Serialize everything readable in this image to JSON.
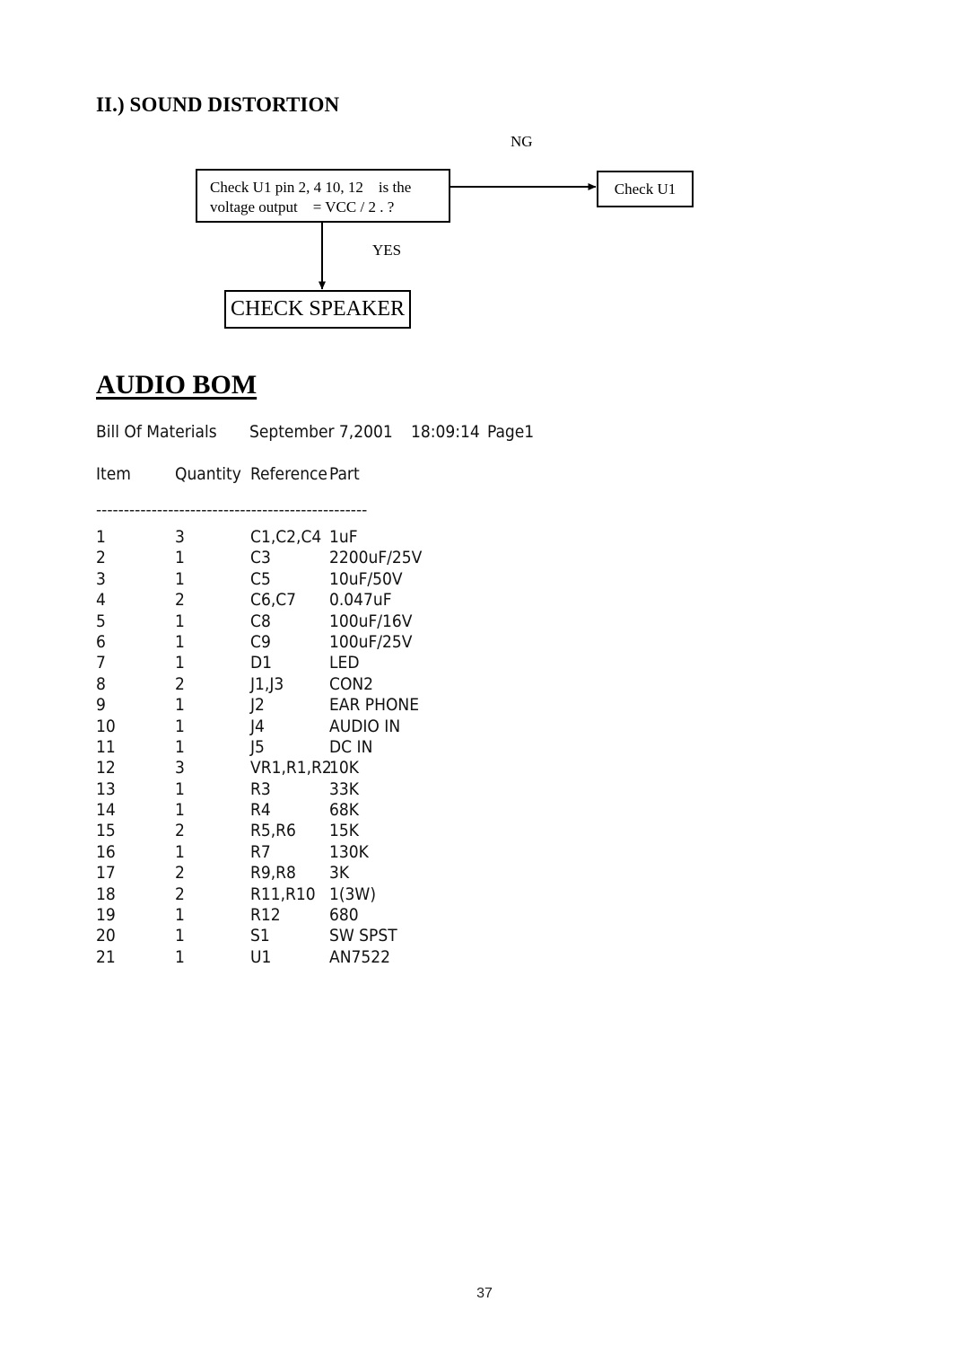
{
  "document": {
    "section_heading": "II.) SOUND DISTORTION",
    "page_number": "37"
  },
  "flowchart": {
    "decision_line1": "Check U1 pin 2, 4 10, 12    is the",
    "decision_line2": "voltage output    = VCC / 2 . ?",
    "branch_ng_label": "NG",
    "branch_yes_label": "YES",
    "ng_target": "Check U1",
    "yes_target": "CHECK SPEAKER"
  },
  "bom": {
    "heading": "AUDIO BOM",
    "meta": {
      "title": "Bill Of Materials",
      "date": "September 7,2001",
      "time": "18:09:14",
      "page": "Page1"
    },
    "columns": {
      "item": "Item",
      "quantity": "Quantity",
      "reference": "Reference",
      "part": "Part"
    },
    "separator": "-------------------------------------------------",
    "rows": [
      {
        "item": "1",
        "quantity": "3",
        "reference": "C1,C2,C4",
        "part": "1uF"
      },
      {
        "item": "2",
        "quantity": "1",
        "reference": "C3",
        "part": "2200uF/25V"
      },
      {
        "item": "3",
        "quantity": "1",
        "reference": "C5",
        "part": "10uF/50V"
      },
      {
        "item": "4",
        "quantity": "2",
        "reference": "C6,C7",
        "part": "0.047uF"
      },
      {
        "item": "5",
        "quantity": "1",
        "reference": "C8",
        "part": "100uF/16V"
      },
      {
        "item": "6",
        "quantity": "1",
        "reference": "C9",
        "part": "100uF/25V"
      },
      {
        "item": "7",
        "quantity": "1",
        "reference": "D1",
        "part": "LED"
      },
      {
        "item": "8",
        "quantity": "2",
        "reference": "J1,J3",
        "part": "CON2"
      },
      {
        "item": "9",
        "quantity": "1",
        "reference": "J2",
        "part": "EAR PHONE"
      },
      {
        "item": "10",
        "quantity": "1",
        "reference": "J4",
        "part": "AUDIO IN"
      },
      {
        "item": "11",
        "quantity": "1",
        "reference": "J5",
        "part": "DC IN"
      },
      {
        "item": "12",
        "quantity": "3",
        "reference": "VR1,R1,R2",
        "part": "10K"
      },
      {
        "item": "13",
        "quantity": "1",
        "reference": "R3",
        "part": "33K"
      },
      {
        "item": "14",
        "quantity": "1",
        "reference": "R4",
        "part": "68K"
      },
      {
        "item": "15",
        "quantity": "2",
        "reference": "R5,R6",
        "part": "15K"
      },
      {
        "item": "16",
        "quantity": "1",
        "reference": "R7",
        "part": "130K"
      },
      {
        "item": "17",
        "quantity": "2",
        "reference": "R9,R8",
        "part": "3K"
      },
      {
        "item": "18",
        "quantity": "2",
        "reference": "R11,R10",
        "part": "1(3W)"
      },
      {
        "item": "19",
        "quantity": "1",
        "reference": "R12",
        "part": "680"
      },
      {
        "item": "20",
        "quantity": "1",
        "reference": "S1",
        "part": "SW SPST"
      },
      {
        "item": "21",
        "quantity": "1",
        "reference": "U1",
        "part": "AN7522"
      }
    ]
  }
}
